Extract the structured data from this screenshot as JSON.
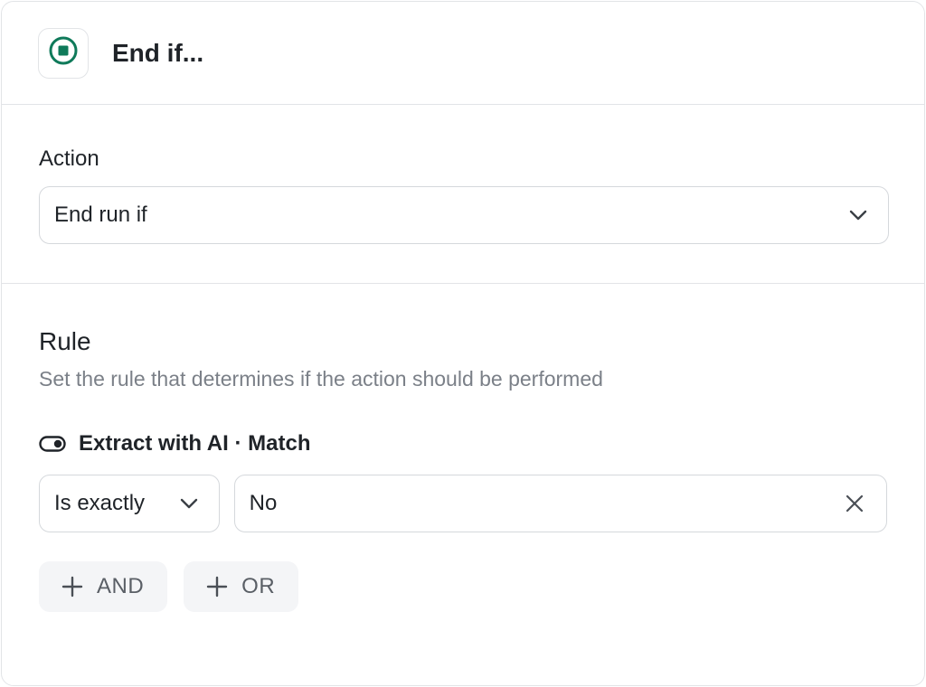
{
  "header": {
    "title": "End if...",
    "icon": "stop-circle-icon",
    "accent": "#0f7a5a"
  },
  "action": {
    "label": "Action",
    "value": "End run if",
    "icon": "chevron-down-icon"
  },
  "rule": {
    "title": "Rule",
    "description": "Set the rule that determines if the action should be performed",
    "source": {
      "icon": "toggle-icon",
      "label": "Extract with AI · Match"
    },
    "operator": {
      "value": "Is exactly",
      "icon": "chevron-down-icon"
    },
    "value": {
      "text": "No",
      "icon": "close-icon"
    },
    "buttons": {
      "and_label": "AND",
      "or_label": "OR",
      "icon": "plus-icon"
    }
  }
}
